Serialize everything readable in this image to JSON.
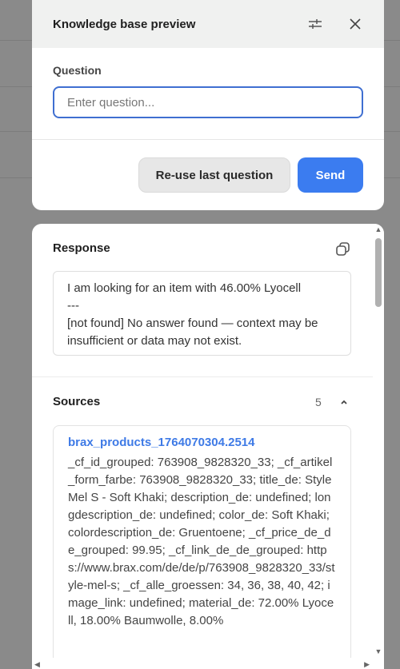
{
  "dialog": {
    "title": "Knowledge base preview",
    "question_label": "Question",
    "question_placeholder": "Enter question...",
    "question_value": "",
    "reuse_label": "Re-use last question",
    "send_label": "Send",
    "send_color": "#3b7cf0"
  },
  "response": {
    "label": "Response",
    "lines": [
      "I am looking for an item with 46.00% Lyocell",
      "---",
      "[not found] No answer found — context may be insufficient or data may not exist."
    ]
  },
  "sources": {
    "label": "Sources",
    "count": "5",
    "items": [
      {
        "title": "brax_products_1764070304.2514",
        "text": "_cf_id_grouped: 763908_9828320_33; _cf_artikel_form_farbe: 763908_9828320_33; title_de: Style Mel S - Soft Khaki; description_de: undefined; longdescription_de: undefined; color_de: Soft Khaki; colordescription_de: Gruentoene; _cf_price_de_de_grouped: 99.95; _cf_link_de_de_grouped: https://www.brax.com/de/de/p/763908_9828320_33/style-mel-s; _cf_alle_groessen: 34, 36, 38, 40, 42; image_link: undefined; material_de: 72.00% Lyocell, 18.00% Baumwolle, 8.00%"
      }
    ]
  },
  "icons": {
    "settings": "sliders-icon",
    "close": "close-icon",
    "copy": "copy-icon",
    "collapse": "chevron-up-icon"
  }
}
